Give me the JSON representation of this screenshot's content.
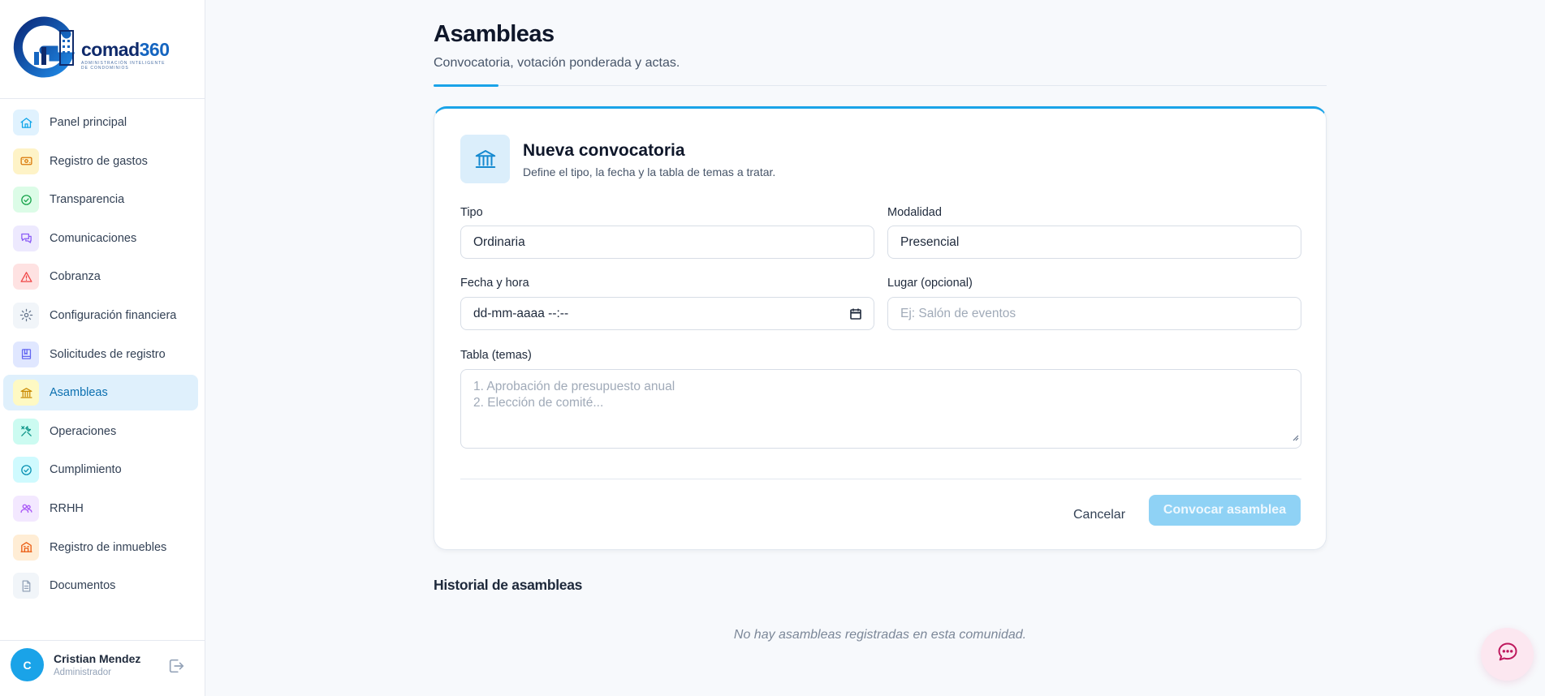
{
  "brand": {
    "name": "comad",
    "number": "360",
    "tagline": "ADMINISTRACIÓN INTELIGENTE DE CONDOMINIOS"
  },
  "sidebar": {
    "items": [
      {
        "label": "Panel principal",
        "icon": "home-icon",
        "color": "#e0f2fe",
        "stroke": "#0ea5e9"
      },
      {
        "label": "Registro de gastos",
        "icon": "receipt-icon",
        "color": "#fef3c7",
        "stroke": "#d97706"
      },
      {
        "label": "Transparencia",
        "icon": "check-circle-icon",
        "color": "#dcfce7",
        "stroke": "#16a34a"
      },
      {
        "label": "Comunicaciones",
        "icon": "chat-icon",
        "color": "#ede9fe",
        "stroke": "#8b5cf6"
      },
      {
        "label": "Cobranza",
        "icon": "alert-triangle-icon",
        "color": "#fee2e2",
        "stroke": "#ef4444"
      },
      {
        "label": "Configuración financiera",
        "icon": "gear-icon",
        "color": "#f1f5f9",
        "stroke": "#64748b"
      },
      {
        "label": "Solicitudes de registro",
        "icon": "book-icon",
        "color": "#e0e7ff",
        "stroke": "#6366f1"
      },
      {
        "label": "Asambleas",
        "icon": "bank-icon",
        "color": "#fef9c3",
        "stroke": "#ca8a04"
      },
      {
        "label": "Operaciones",
        "icon": "tools-icon",
        "color": "#ccfbf1",
        "stroke": "#0d9488"
      },
      {
        "label": "Cumplimiento",
        "icon": "check-circle-icon",
        "color": "#cffafe",
        "stroke": "#0891b2"
      },
      {
        "label": "RRHH",
        "icon": "users-icon",
        "color": "#f3e8ff",
        "stroke": "#a855f7"
      },
      {
        "label": "Registro de inmuebles",
        "icon": "building-icon",
        "color": "#ffedd5",
        "stroke": "#ea580c"
      },
      {
        "label": "Documentos",
        "icon": "document-icon",
        "color": "#f1f5f9",
        "stroke": "#94a3b8"
      }
    ],
    "active_index": 7
  },
  "user": {
    "initial": "C",
    "name": "Cristian Mendez",
    "role": "Administrador"
  },
  "header": {
    "title": "Asambleas",
    "subtitle": "Convocatoria, votación ponderada y actas."
  },
  "form": {
    "title": "Nueva convocatoria",
    "subtitle": "Define el tipo, la fecha y la tabla de temas a tratar.",
    "tipo_label": "Tipo",
    "tipo_value": "Ordinaria",
    "modalidad_label": "Modalidad",
    "modalidad_value": "Presencial",
    "fecha_label": "Fecha y hora",
    "fecha_value": "dd-mm-aaaa --:--",
    "lugar_label": "Lugar (opcional)",
    "lugar_placeholder": "Ej: Salón de eventos",
    "tabla_label": "Tabla (temas)",
    "tabla_placeholder_line1": "1. Aprobación de presupuesto anual",
    "tabla_placeholder_line2": "2. Elección de comité...",
    "cancel_label": "Cancelar",
    "submit_label": "Convocar asamblea"
  },
  "history": {
    "title": "Historial de asambleas",
    "empty": "No hay asambleas registradas en esta comunidad."
  },
  "colors": {
    "accent": "#1aa3e8",
    "active_bg": "#dff0fc",
    "primary_disabled": "#8fd2f5"
  }
}
